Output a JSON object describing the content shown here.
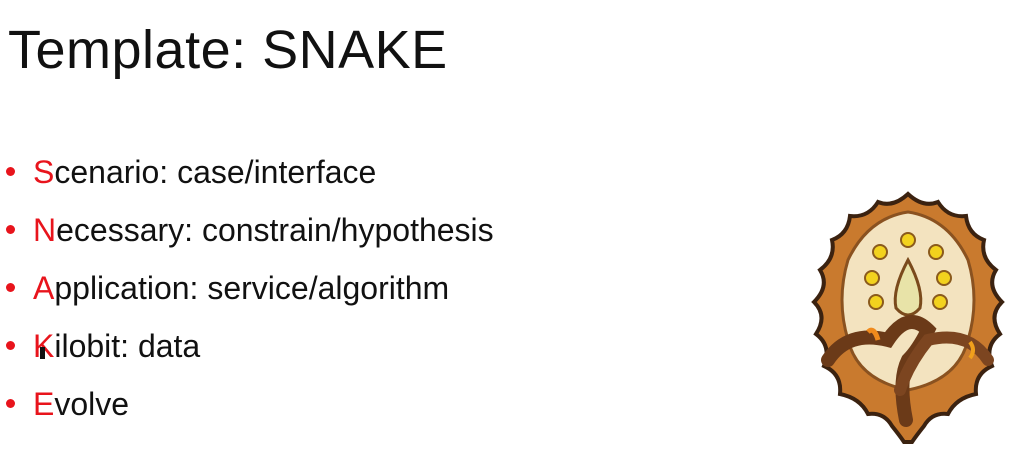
{
  "slide": {
    "title": "Template: SNAKE",
    "bullets": [
      {
        "letter": "S",
        "rest": "cenario: case/interface"
      },
      {
        "letter": "N",
        "rest": "ecessary: constrain/hypothesis"
      },
      {
        "letter": "A",
        "rest": "pplication: service/algorithm"
      },
      {
        "letter": "K",
        "rest": "ilobit: data"
      },
      {
        "letter": "E",
        "rest": "volve"
      }
    ],
    "accent_color": "#e8141c",
    "image": "snake-emblem"
  }
}
